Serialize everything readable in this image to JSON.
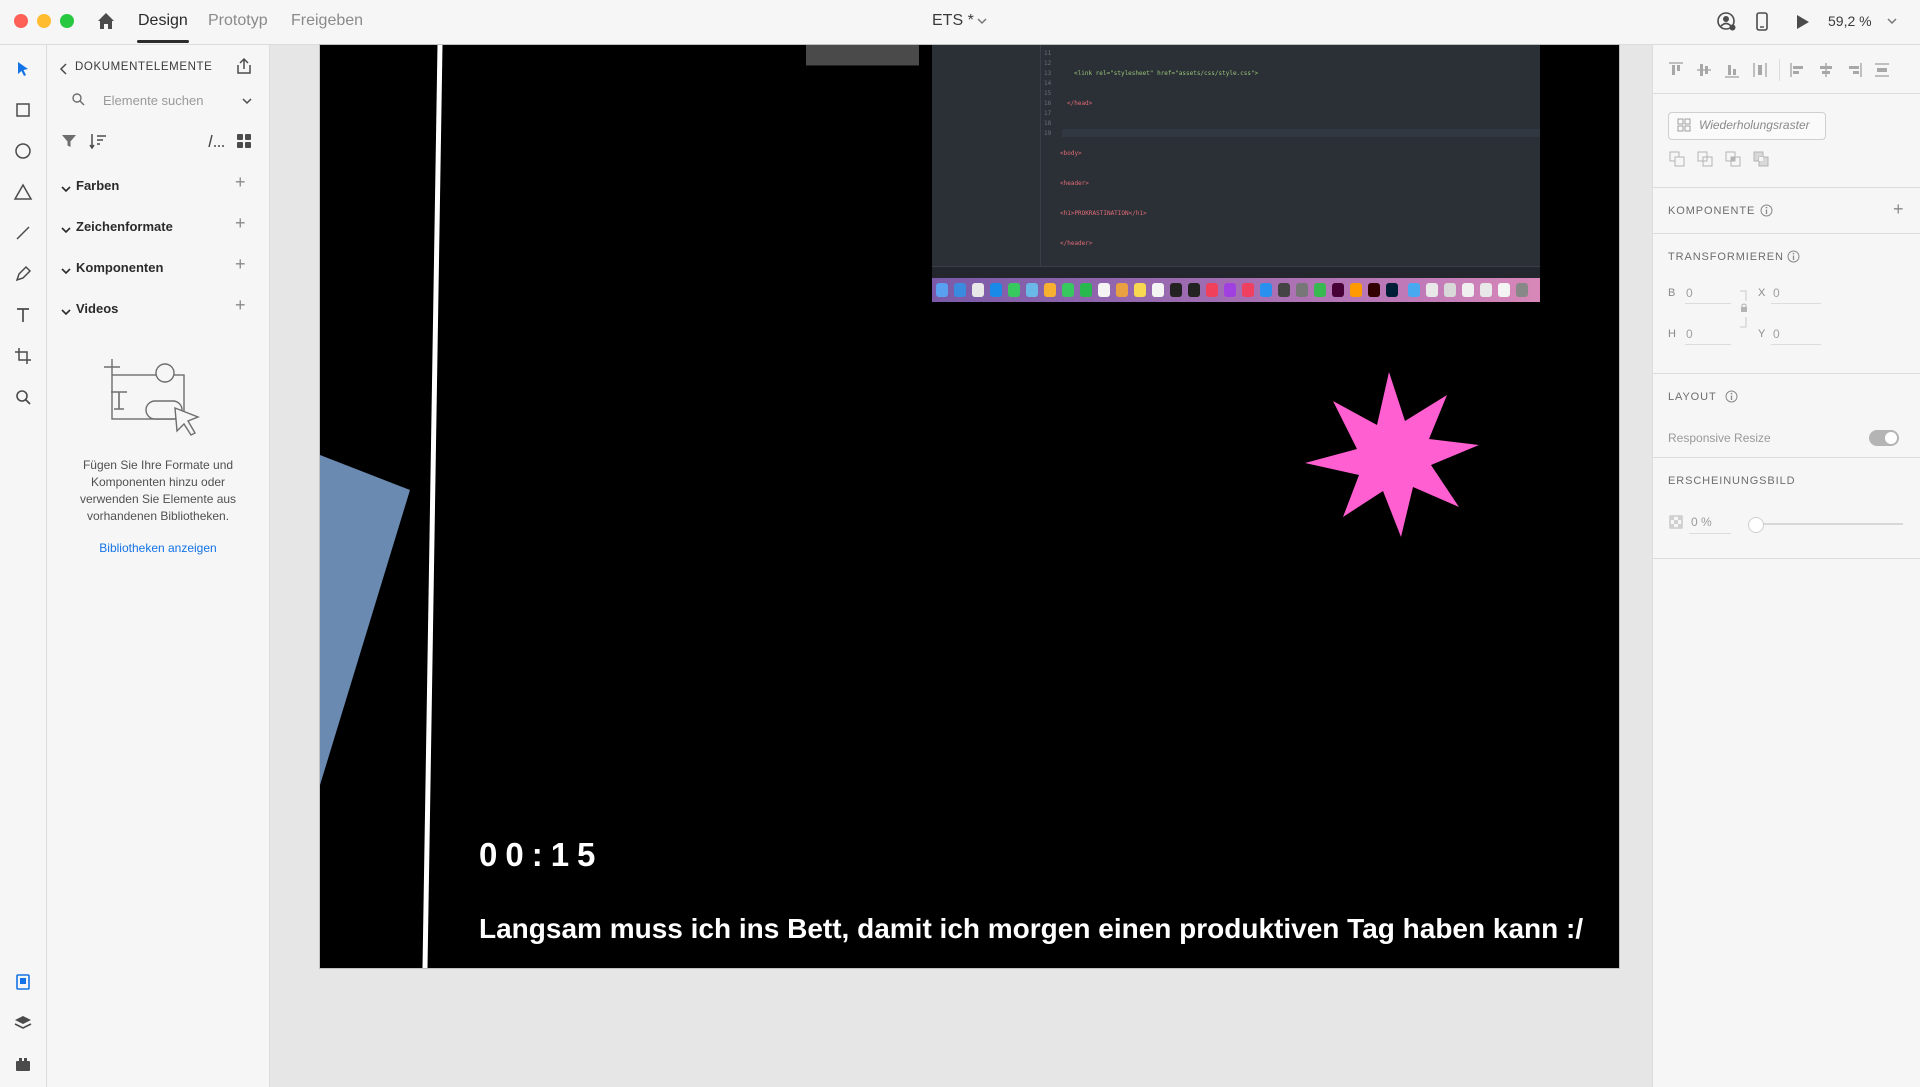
{
  "topbar": {
    "tabs": [
      {
        "label": "Design"
      },
      {
        "label": "Prototyp"
      },
      {
        "label": "Freigeben"
      }
    ],
    "doc_title": "ETS *",
    "zoom": "59,2 %"
  },
  "left_panel": {
    "title": "DOKUMENTELEMENTE",
    "search_placeholder": "Elemente suchen",
    "sections": [
      {
        "label": "Farben"
      },
      {
        "label": "Zeichenformate"
      },
      {
        "label": "Komponenten"
      },
      {
        "label": "Videos"
      }
    ],
    "empty_text": "Fügen Sie Ihre Formate und Komponenten hinzu oder verwenden Sie Elemente aus vorhandenen Bibliotheken.",
    "library_link": "Bibliotheken anzeigen"
  },
  "canvas": {
    "timer": "00:15",
    "caption": "Langsam muss ich ins Bett, damit ich morgen einen produktiven Tag haben kann :/",
    "code_lines": [
      "<link rel=\"stylesheet\" href=\"assets/css/style.css\">",
      "</head>",
      "",
      "<body>",
      "<header>",
      "<h1>PROKRASTINATION</h1>",
      "</header>"
    ],
    "code_line_numbers": [
      "11",
      "12",
      "13",
      "14",
      "15",
      "16",
      "17",
      "18",
      "19"
    ],
    "shape_colors": {
      "star": "#ff5fd0",
      "triangle": "#6a8ab2"
    }
  },
  "right_panel": {
    "repeat_grid": "Wiederholungsraster",
    "component_head": "KOMPONENTE",
    "transform_head": "TRANSFORMIEREN",
    "fields": [
      {
        "label": "B",
        "value": "0"
      },
      {
        "label": "X",
        "value": "0"
      },
      {
        "label": "H",
        "value": "0"
      },
      {
        "label": "Y",
        "value": "0"
      }
    ],
    "layout_head": "LAYOUT",
    "responsive_resize": "Responsive Resize",
    "appearance_head": "ERSCHEINUNGSBILD",
    "opacity": "0 %"
  }
}
